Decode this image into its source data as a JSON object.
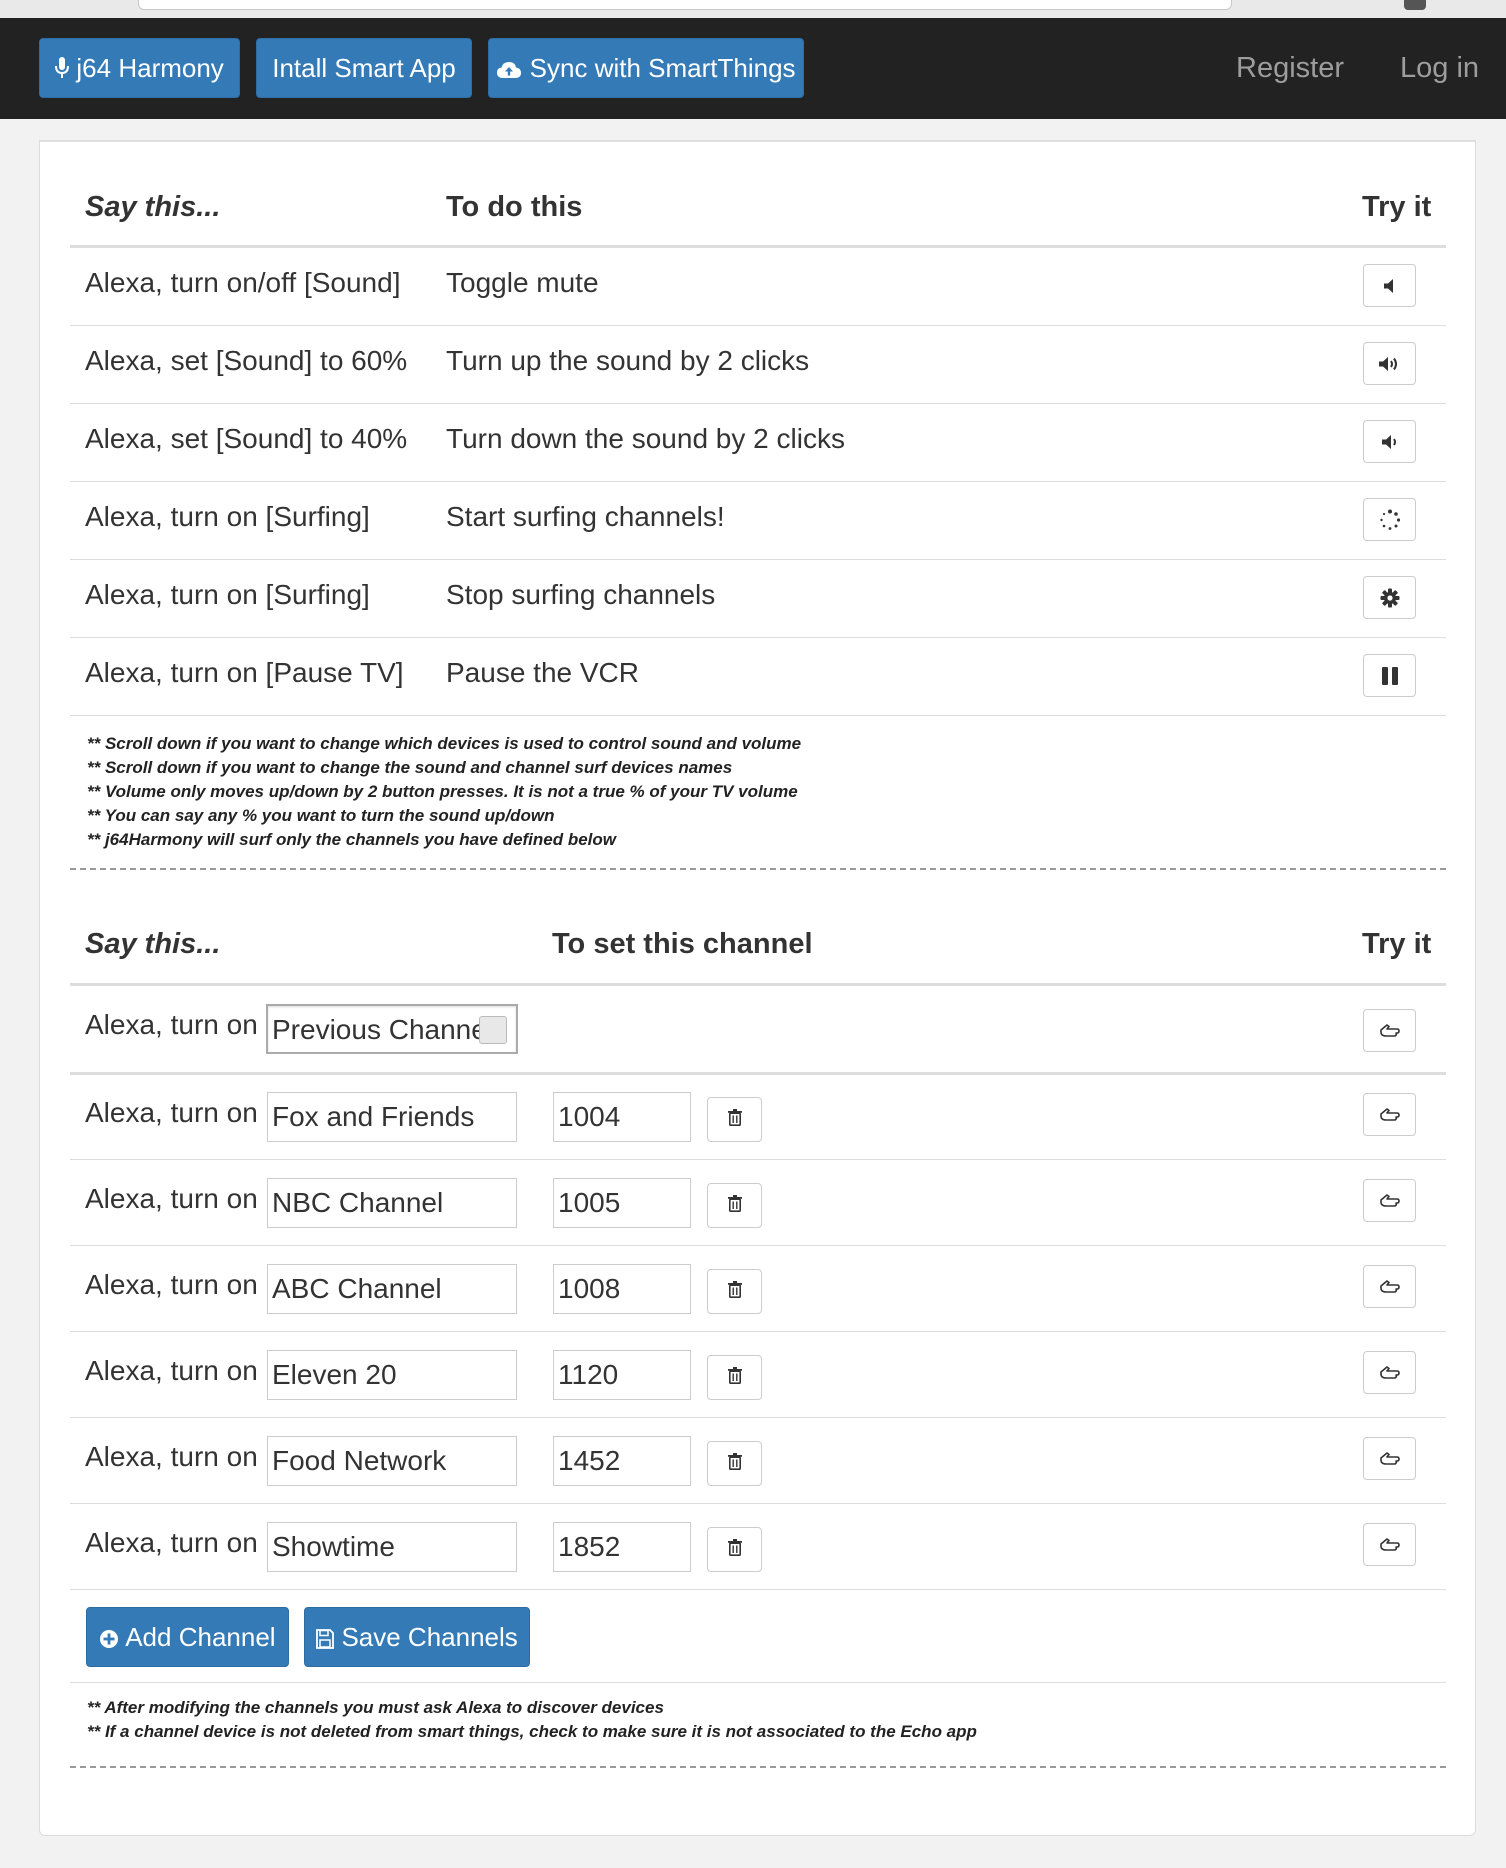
{
  "navbar": {
    "brand_label": "j64 Harmony",
    "install_label": "Intall Smart App",
    "sync_label": "Sync with SmartThings",
    "register_label": "Register",
    "login_label": "Log in"
  },
  "commands": {
    "headers": {
      "say": "Say this...",
      "do": "To do this",
      "try": "Try it"
    },
    "rows": [
      {
        "say": "Alexa, turn on/off [Sound]",
        "do": "Toggle mute",
        "icon": "volume-off-icon"
      },
      {
        "say": "Alexa, set [Sound] to 60%",
        "do": "Turn up the sound by 2 clicks",
        "icon": "volume-up-icon"
      },
      {
        "say": "Alexa, set [Sound] to 40%",
        "do": "Turn down the sound by 2 clicks",
        "icon": "volume-down-icon"
      },
      {
        "say": "Alexa, turn on [Surfing]",
        "do": "Start surfing channels!",
        "icon": "spinner-icon"
      },
      {
        "say": "Alexa, turn on [Surfing]",
        "do": "Stop surfing channels",
        "icon": "gear-icon"
      },
      {
        "say": "Alexa, turn on [Pause TV]",
        "do": "Pause the VCR",
        "icon": "pause-icon"
      }
    ],
    "notes": [
      "** Scroll down if you want to change which devices is used to control sound and volume",
      "** Scroll down if you want to change the sound and channel surf devices names",
      "** Volume only moves up/down by 2 button presses. It is not a true % of your TV volume",
      "** You can say any % you want to turn the sound up/down",
      "** j64Harmony will surf only the channels you have defined below"
    ]
  },
  "channels": {
    "headers": {
      "say": "Say this...",
      "set": "To set this channel",
      "try": "Try it"
    },
    "prefix": "Alexa, turn on",
    "previous": {
      "name": "Previous Channel"
    },
    "rows": [
      {
        "name": "Fox and Friends",
        "number": "1004"
      },
      {
        "name": "NBC Channel",
        "number": "1005"
      },
      {
        "name": "ABC Channel",
        "number": "1008"
      },
      {
        "name": "Eleven 20",
        "number": "1120"
      },
      {
        "name": "Food Network",
        "number": "1452"
      },
      {
        "name": "Showtime",
        "number": "1852"
      }
    ],
    "add_label": "Add Channel",
    "save_label": "Save Channels",
    "notes": [
      "** After modifying the channels you must ask Alexa to discover devices",
      "** If a channel device is not deleted from smart things, check to make sure it is not associated to the Echo app"
    ]
  },
  "colors": {
    "navbar": "#222222",
    "primary": "#337ab7",
    "nav_link": "#9d9d9d"
  }
}
